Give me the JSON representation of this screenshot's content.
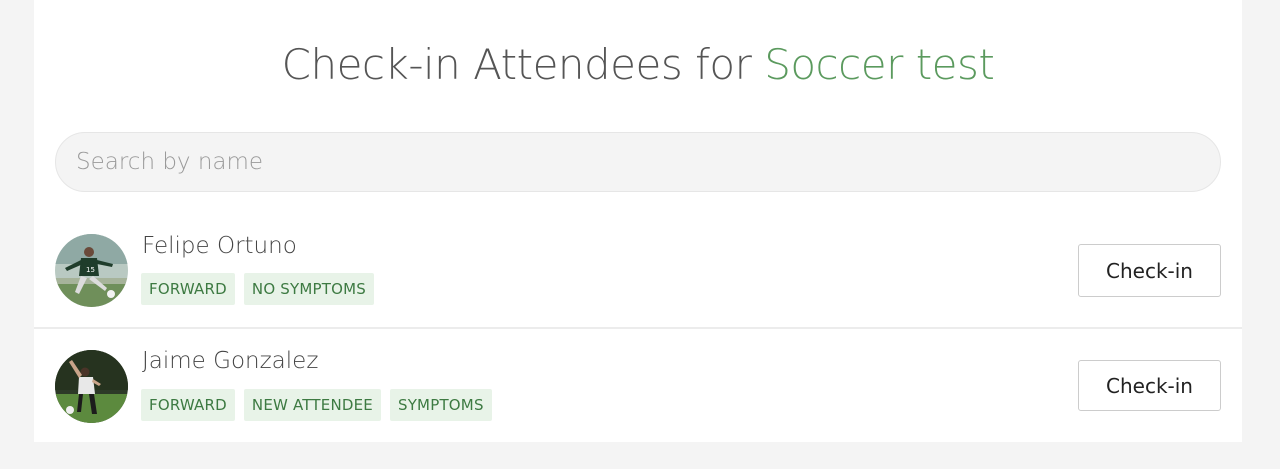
{
  "header": {
    "title_prefix": "Check-in Attendees for ",
    "event_name": "Soccer test"
  },
  "search": {
    "placeholder": "Search by name",
    "value": ""
  },
  "attendees": [
    {
      "name": "Felipe Ortuno",
      "tags": [
        "FORWARD",
        "NO SYMPTOMS"
      ],
      "action_label": "Check-in",
      "avatar_icon": "player-photo-avatar"
    },
    {
      "name": "Jaime Gonzalez",
      "tags": [
        "FORWARD",
        "NEW ATTENDEE",
        "SYMPTOMS"
      ],
      "action_label": "Check-in",
      "avatar_icon": "player-photo-avatar"
    }
  ],
  "colors": {
    "accent": "#5b9a5e",
    "tag_bg": "#e8f3e8",
    "tag_text": "#3d7a42",
    "page_bg": "#f4f4f4"
  }
}
